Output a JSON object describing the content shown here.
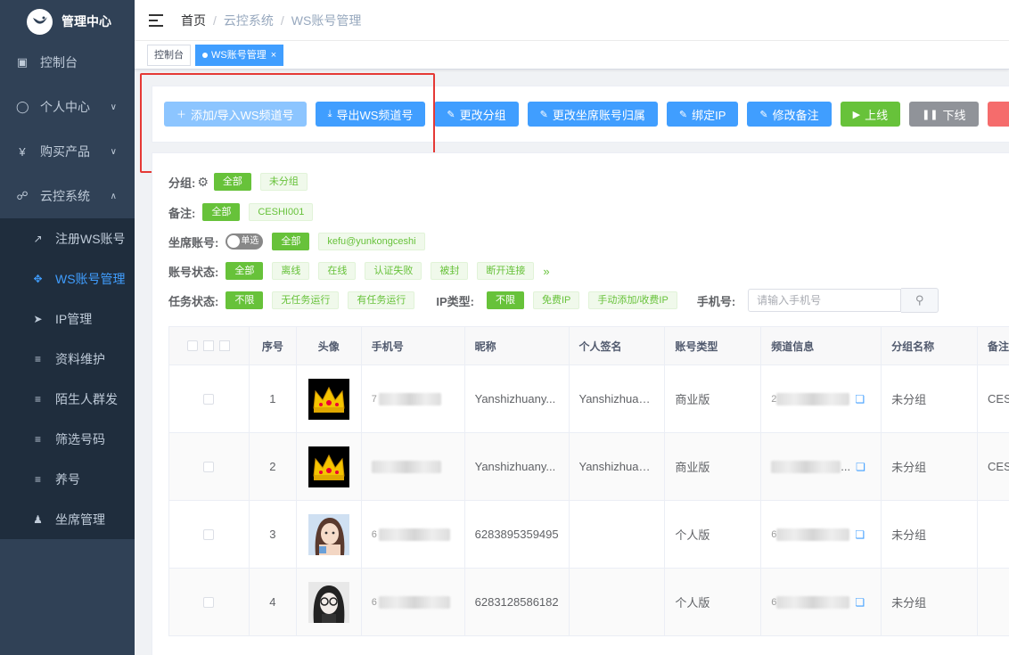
{
  "sidebar": {
    "title": "管理中心",
    "items": [
      {
        "label": "控制台",
        "icon": "dashboard-icon"
      },
      {
        "label": "个人中心",
        "icon": "user-circle-icon"
      },
      {
        "label": "购买产品",
        "icon": "yen-icon"
      },
      {
        "label": "云控系统",
        "icon": "headset-icon"
      }
    ],
    "sub": [
      {
        "label": "注册WS账号",
        "icon": "external-link-icon"
      },
      {
        "label": "WS账号管理",
        "icon": "move-icon"
      },
      {
        "label": "IP管理",
        "icon": "send-icon"
      },
      {
        "label": "资料维护",
        "icon": "sliders-icon"
      },
      {
        "label": "陌生人群发",
        "icon": "sliders-icon"
      },
      {
        "label": "筛选号码",
        "icon": "sliders-icon"
      },
      {
        "label": "养号",
        "icon": "sliders-icon"
      },
      {
        "label": "坐席管理",
        "icon": "agent-icon"
      }
    ]
  },
  "breadcrumb": [
    "首页",
    "云控系统",
    "WS账号管理"
  ],
  "tags": [
    {
      "label": "控制台"
    },
    {
      "label": "WS账号管理",
      "close": "×"
    }
  ],
  "toolbar": {
    "add": "添加/导入WS频道号",
    "export": "导出WS频道号",
    "change_group": "更改分组",
    "change_agent": "更改坐席账号归属",
    "bind_ip": "绑定IP",
    "edit_note": "修改备注",
    "online": "上线",
    "offline": "下线"
  },
  "filters": {
    "group": {
      "label": "分组:",
      "opts": [
        "全部",
        "未分组"
      ]
    },
    "note": {
      "label": "备注:",
      "opts": [
        "全部",
        "CESHI001"
      ]
    },
    "agent": {
      "label": "坐席账号:",
      "toggle": "单选",
      "opts": [
        "全部",
        "kefu@yunkongceshi"
      ]
    },
    "status": {
      "label": "账号状态:",
      "opts": [
        "全部",
        "离线",
        "在线",
        "认证失败",
        "被封",
        "断开连接"
      ],
      "more": "»"
    },
    "task": {
      "label": "任务状态:",
      "opts": [
        "不限",
        "无任务运行",
        "有任务运行"
      ]
    },
    "iptype": {
      "label": "IP类型:",
      "opts": [
        "不限",
        "免费IP",
        "手动添加/收费IP"
      ]
    },
    "phone": {
      "label": "手机号:",
      "placeholder": "请输入手机号"
    }
  },
  "table": {
    "headers": [
      "序号",
      "头像",
      "手机号",
      "昵称",
      "个人签名",
      "账号类型",
      "频道信息",
      "分组名称",
      "备注"
    ],
    "rows": [
      {
        "no": "1",
        "avatar": "crown",
        "phone_blur": "7",
        "phone": "",
        "nick": "Yanshizhuany...",
        "sign": "Yanshizhuan...",
        "type": "商业版",
        "channel": "2",
        "group": "未分组",
        "note": "CES"
      },
      {
        "no": "2",
        "avatar": "crown",
        "phone_blur": "",
        "phone": "",
        "nick": "Yanshizhuany...",
        "sign": "Yanshizhuan...",
        "type": "商业版",
        "channel": "...",
        "group": "未分组",
        "note": "CES"
      },
      {
        "no": "3",
        "avatar": "girl",
        "phone_blur": "6",
        "phone": "6283895359495",
        "nick": "",
        "sign": "",
        "type": "个人版",
        "channel": "6",
        "group": "未分组",
        "note": ""
      },
      {
        "no": "4",
        "avatar": "girl2",
        "phone_blur": "6",
        "phone": "6283128586182",
        "nick": "",
        "sign": "",
        "type": "个人版",
        "channel": "6",
        "group": "未分组",
        "note": ""
      }
    ]
  }
}
